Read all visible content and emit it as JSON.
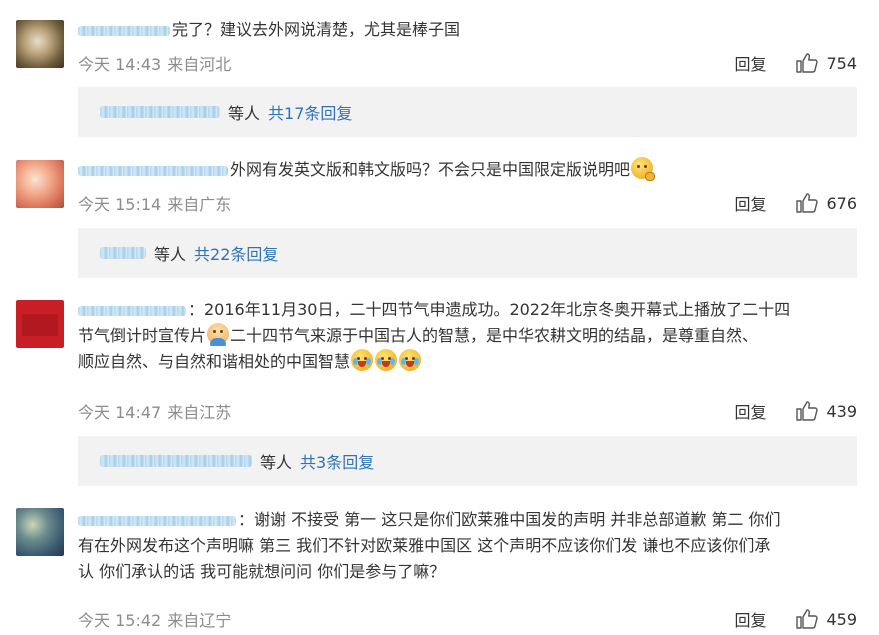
{
  "comments": [
    {
      "text": "完了？建议去外网说清楚，尤其是棒子国",
      "time": "今天 14:43",
      "location": "来自河北",
      "reply_label": "回复",
      "likes": "754",
      "replies": {
        "etc": "等人",
        "total": "共17条回复"
      }
    },
    {
      "text": "外网有发英文版和韩文版吗？不会只是中国限定版说明吧",
      "time": "今天 15:14",
      "location": "来自广东",
      "reply_label": "回复",
      "likes": "676",
      "replies": {
        "etc": "等人",
        "total": "共22条回复"
      }
    },
    {
      "text_line1": "：2016年11月30日，二十四节气申遗成功。2022年北京冬奥开幕式上播放了二十四",
      "text_line2a": "节气倒计时宣传片",
      "text_line2b": "二十四节气来源于中国古人的智慧，是中华农耕文明的结晶，是尊重自然、",
      "text_line3": "顺应自然、与自然和谐相处的中国智慧",
      "time": "今天 14:47",
      "location": "来自江苏",
      "reply_label": "回复",
      "likes": "439",
      "replies": {
        "etc": "等人",
        "total": "共3条回复"
      }
    },
    {
      "text_line1": "：谢谢 不接受 第一 这只是你们欧莱雅中国发的声明 并非总部道歉 第二 你们",
      "text_line2": "有在外网发布这个声明嘛 第三 我们不针对欧莱雅中国区 这个声明不应该你们发 谦也不应该你们承",
      "text_line3": "认 你们承认的话 我可能就想问问 你们是参与了嘛？",
      "time": "今天 15:42",
      "location": "来自辽宁",
      "reply_label": "回复",
      "likes": "459"
    }
  ],
  "icons": {
    "like": "thumbs-up-icon"
  },
  "colors": {
    "link": "#2f73b5",
    "meta": "#8c8c8c",
    "reply_bg": "#f2f2f2"
  }
}
